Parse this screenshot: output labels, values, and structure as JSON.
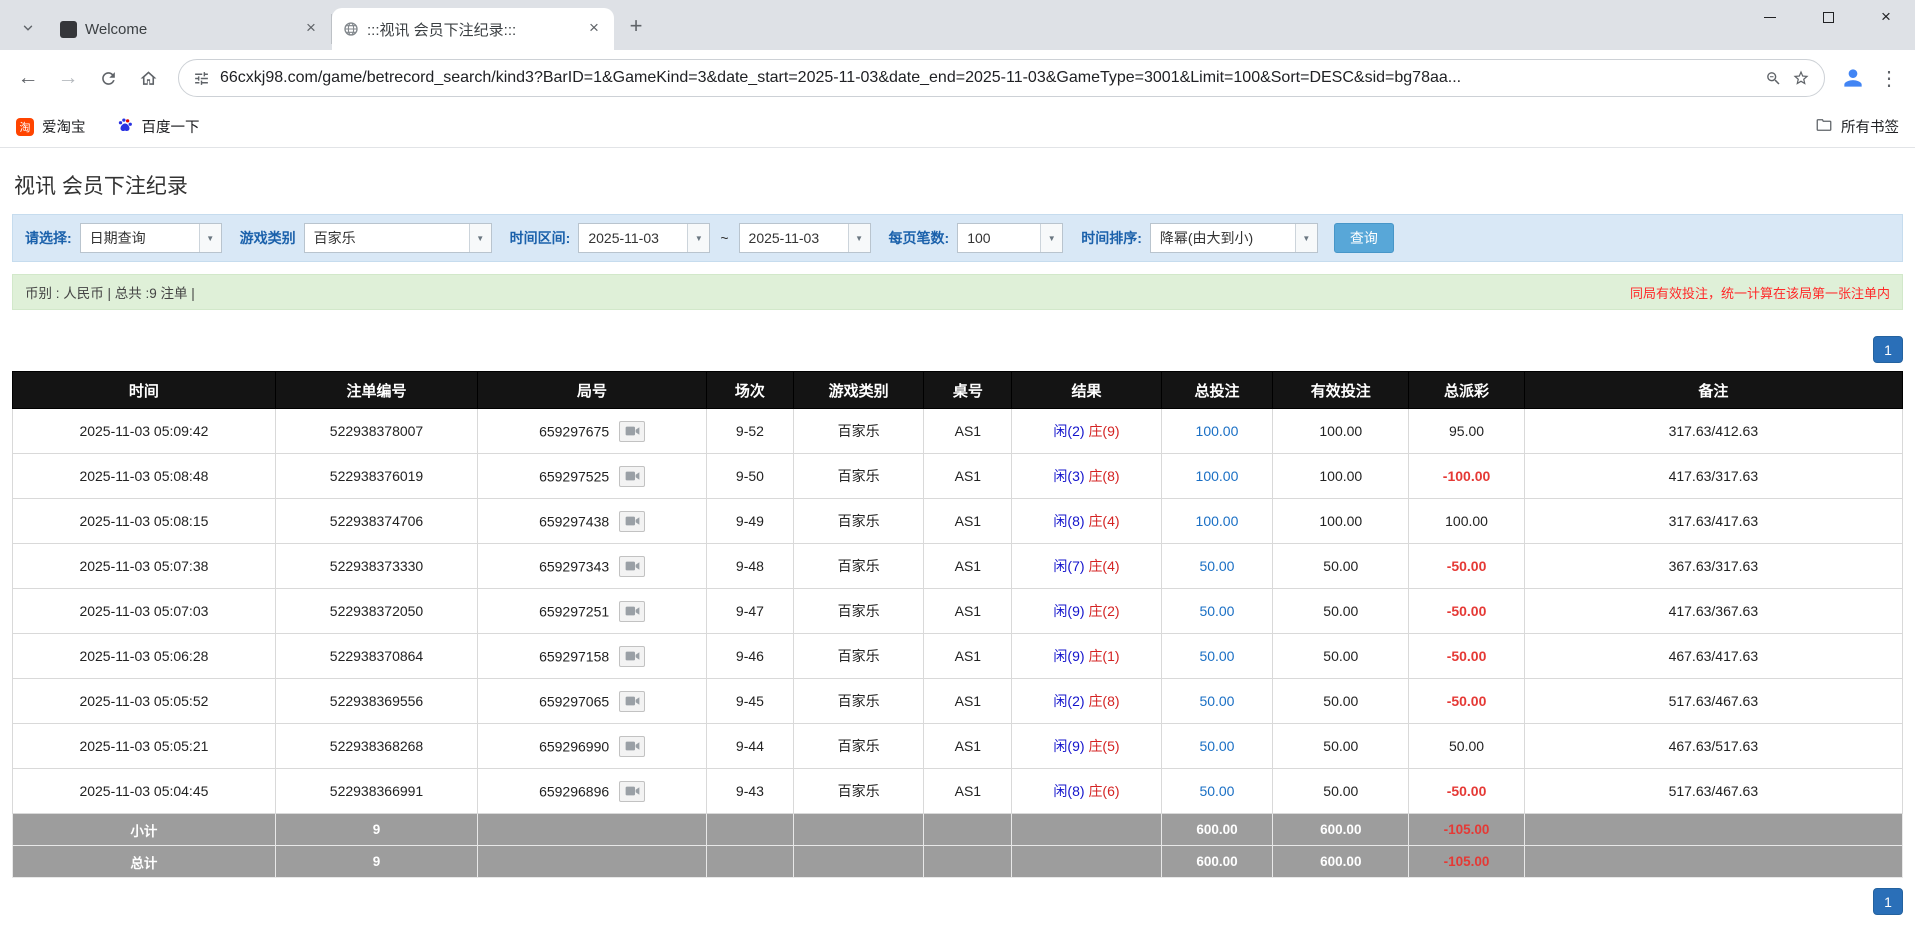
{
  "colors": {
    "player_blue": "#1414cc",
    "banker_red": "#d42323",
    "link_blue": "#1a6fc4",
    "negative_red": "#e53935",
    "pagination_blue": "#2a6fb8",
    "filter_bar_bg": "#d9e8f6",
    "summary_bar_bg": "#dff0d8",
    "summary_note_red": "#ff2a2a",
    "table_header_bg": "#141414",
    "table_footer_bg": "#9d9d9d",
    "search_button_bg": "#58a7d8",
    "filter_label_blue": "#1b61ab"
  },
  "icons": {
    "tab_close": "×",
    "window_close": "×",
    "new_tab": "+",
    "back_arrow": "←",
    "forward_arrow": "→",
    "menu_dots": "⋮",
    "dropdown_arrow": "▼",
    "taobao_glyph": "淘"
  },
  "browser": {
    "tabs": [
      {
        "title": "Welcome"
      },
      {
        "title": ":::视讯 会员下注纪录:::"
      }
    ],
    "url": "66cxkj98.com/game/betrecord_search/kind3?BarID=1&GameKind=3&date_start=2025-11-03&date_end=2025-11-03&GameType=3001&Limit=100&Sort=DESC&sid=bg78aa...",
    "bookmarks": [
      {
        "label": "爱淘宝"
      },
      {
        "label": "百度一下"
      }
    ],
    "all_bookmarks_label": "所有书签"
  },
  "page": {
    "title": "视讯 会员下注纪录",
    "filters": {
      "select_label": "请选择:",
      "query_type": "日期查询",
      "game_category_label": "游戏类别",
      "game_category": "百家乐",
      "date_range_label": "时间区间:",
      "date_start": "2025-11-03",
      "date_separator": "~",
      "date_end": "2025-11-03",
      "page_size_label": "每页笔数:",
      "page_size": "100",
      "sort_label": "时间排序:",
      "sort_value": "降幂(由大到小)",
      "search_button": "查询"
    },
    "summary": {
      "left": "币别 : 人民币 | 总共 :9 注单 |",
      "right": "同局有效投注，统一计算在该局第一张注单内"
    },
    "pagination": "1",
    "table": {
      "headers": [
        "时间",
        "注单编号",
        "局号",
        "场次",
        "游戏类别",
        "桌号",
        "结果",
        "总投注",
        "有效投注",
        "总派彩",
        "备注"
      ],
      "rows": [
        {
          "time": "2025-11-03 05:09:42",
          "bet_id": "522938378007",
          "round_id": "659297675",
          "session": "9-52",
          "game": "百家乐",
          "table_no": "AS1",
          "result_player": "闲(2)",
          "result_banker": "庄(9)",
          "total_bet": "100.00",
          "valid_bet": "100.00",
          "payout": "95.00",
          "note": "317.63/412.63"
        },
        {
          "time": "2025-11-03 05:08:48",
          "bet_id": "522938376019",
          "round_id": "659297525",
          "session": "9-50",
          "game": "百家乐",
          "table_no": "AS1",
          "result_player": "闲(3)",
          "result_banker": "庄(8)",
          "total_bet": "100.00",
          "valid_bet": "100.00",
          "payout": "-100.00",
          "note": "417.63/317.63"
        },
        {
          "time": "2025-11-03 05:08:15",
          "bet_id": "522938374706",
          "round_id": "659297438",
          "session": "9-49",
          "game": "百家乐",
          "table_no": "AS1",
          "result_player": "闲(8)",
          "result_banker": "庄(4)",
          "total_bet": "100.00",
          "valid_bet": "100.00",
          "payout": "100.00",
          "note": "317.63/417.63"
        },
        {
          "time": "2025-11-03 05:07:38",
          "bet_id": "522938373330",
          "round_id": "659297343",
          "session": "9-48",
          "game": "百家乐",
          "table_no": "AS1",
          "result_player": "闲(7)",
          "result_banker": "庄(4)",
          "total_bet": "50.00",
          "valid_bet": "50.00",
          "payout": "-50.00",
          "note": "367.63/317.63"
        },
        {
          "time": "2025-11-03 05:07:03",
          "bet_id": "522938372050",
          "round_id": "659297251",
          "session": "9-47",
          "game": "百家乐",
          "table_no": "AS1",
          "result_player": "闲(9)",
          "result_banker": "庄(2)",
          "total_bet": "50.00",
          "valid_bet": "50.00",
          "payout": "-50.00",
          "note": "417.63/367.63"
        },
        {
          "time": "2025-11-03 05:06:28",
          "bet_id": "522938370864",
          "round_id": "659297158",
          "session": "9-46",
          "game": "百家乐",
          "table_no": "AS1",
          "result_player": "闲(9)",
          "result_banker": "庄(1)",
          "total_bet": "50.00",
          "valid_bet": "50.00",
          "payout": "-50.00",
          "note": "467.63/417.63"
        },
        {
          "time": "2025-11-03 05:05:52",
          "bet_id": "522938369556",
          "round_id": "659297065",
          "session": "9-45",
          "game": "百家乐",
          "table_no": "AS1",
          "result_player": "闲(2)",
          "result_banker": "庄(8)",
          "total_bet": "50.00",
          "valid_bet": "50.00",
          "payout": "-50.00",
          "note": "517.63/467.63"
        },
        {
          "time": "2025-11-03 05:05:21",
          "bet_id": "522938368268",
          "round_id": "659296990",
          "session": "9-44",
          "game": "百家乐",
          "table_no": "AS1",
          "result_player": "闲(9)",
          "result_banker": "庄(5)",
          "total_bet": "50.00",
          "valid_bet": "50.00",
          "payout": "50.00",
          "note": "467.63/517.63"
        },
        {
          "time": "2025-11-03 05:04:45",
          "bet_id": "522938366991",
          "round_id": "659296896",
          "session": "9-43",
          "game": "百家乐",
          "table_no": "AS1",
          "result_player": "闲(8)",
          "result_banker": "庄(6)",
          "total_bet": "50.00",
          "valid_bet": "50.00",
          "payout": "-50.00",
          "note": "517.63/467.63"
        }
      ],
      "subtotal": {
        "label": "小计",
        "count": "9",
        "total_bet": "600.00",
        "valid_bet": "600.00",
        "payout": "-105.00"
      },
      "total": {
        "label": "总计",
        "count": "9",
        "total_bet": "600.00",
        "valid_bet": "600.00",
        "payout": "-105.00"
      }
    }
  }
}
